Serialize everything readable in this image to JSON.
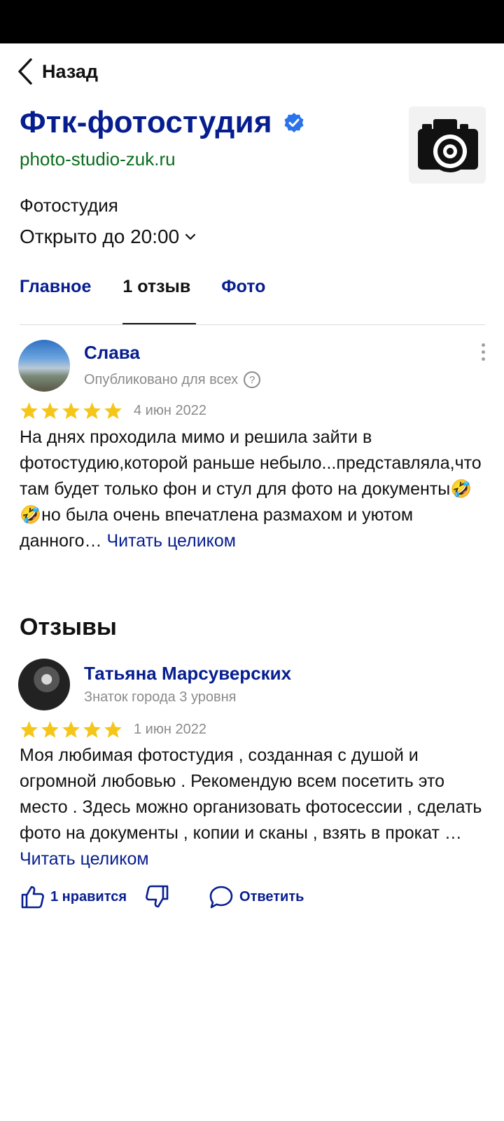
{
  "header": {
    "back_label": "Назад",
    "title": "Фтк-фотостудия",
    "website": "photo-studio-zuk.ru",
    "category": "Фотостудия",
    "hours": "Открыто до 20:00"
  },
  "tabs": [
    {
      "label": "Главное"
    },
    {
      "label": "1 отзыв"
    },
    {
      "label": "Фото"
    }
  ],
  "active_tab": "1 отзыв",
  "review_1": {
    "author": "Слава",
    "subtitle": "Опубликовано для всех",
    "rating": 5,
    "date": "4 июн 2022",
    "text": "На днях проходила мимо и решила зайти в фотостудию,которой раньше небыло...представляла,что там будет только фон и стул для фото на документы🤣🤣но была очень впечатлена размахом и уютом данного… ",
    "read_more": "Читать целиком"
  },
  "section_title": "Отзывы",
  "review_2": {
    "author": "Татьяна Марсуверских",
    "subtitle": "Знаток города 3 уровня",
    "rating": 5,
    "date": "1 июн 2022",
    "text": "Моя любимая фотостудия , созданная с душой и огромной любовью . Рекомендую всем посетить это место . Здесь можно организовать фотосессии , сделать фото на документы , копии и сканы , взять в прокат … ",
    "read_more": "Читать целиком",
    "likes_label": "1 нравится",
    "reply_label": "Ответить"
  },
  "colors": {
    "brand_blue": "#061d8f",
    "website_green": "#0a6d1d",
    "star_yellow": "#f5c518",
    "verified_blue": "#2a73ea",
    "muted_gray": "#8a8a8a"
  },
  "icons": [
    "chevron-left-icon",
    "verified-badge-icon",
    "camera-logo-icon",
    "chevron-down-icon",
    "question-icon",
    "more-vertical-icon",
    "star-icon",
    "thumbs-up-icon",
    "thumbs-down-icon",
    "comment-icon"
  ]
}
